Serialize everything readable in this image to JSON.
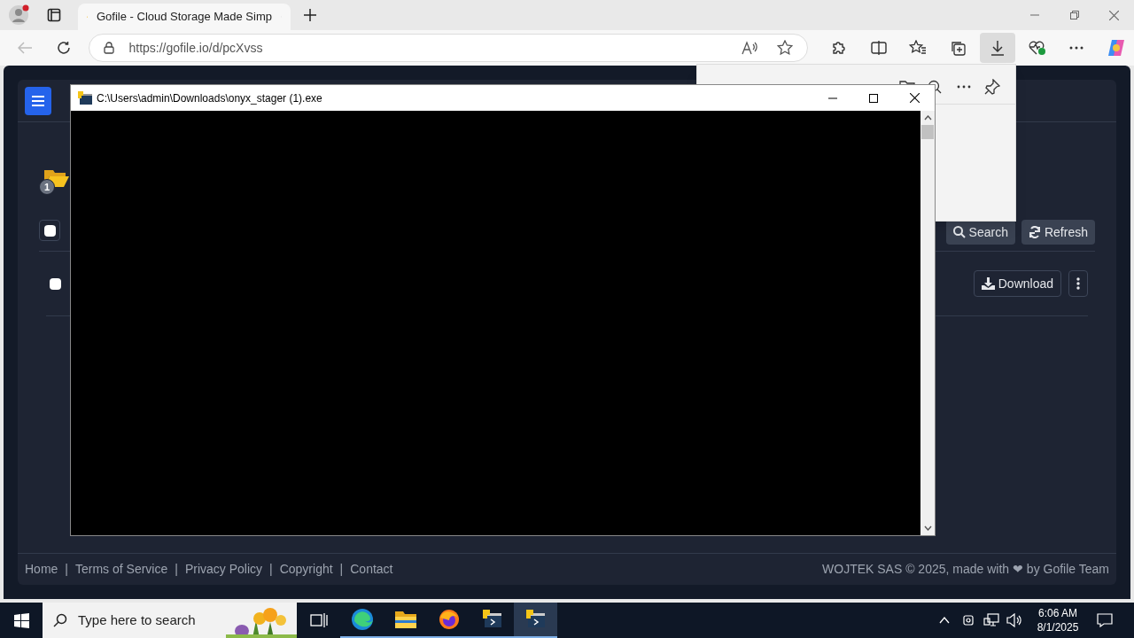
{
  "browser": {
    "tabs": [
      {
        "title": "Gofile - Cloud Storage Made Simp",
        "selected": true
      }
    ],
    "url": "https://gofile.io/d/pcXvss"
  },
  "page": {
    "folder_badge": "1",
    "select_all": {
      "checked": false
    },
    "toolbar_buttons": [
      {
        "kind": "search",
        "label": "Search"
      },
      {
        "kind": "refresh",
        "label": "Refresh"
      }
    ],
    "files": [
      {
        "checked": false,
        "download_label": "Download"
      }
    ],
    "footer_links": [
      "Home",
      "Terms of Service",
      "Privacy Policy",
      "Copyright",
      "Contact"
    ],
    "footer_separator": "|",
    "copyright": "WOJTEK SAS © 2025, made with ❤ by Gofile Team"
  },
  "console_window": {
    "title": "C:\\Users\\admin\\Downloads\\onyx_stager (1).exe"
  },
  "taskbar": {
    "search_placeholder": "Type here to search",
    "apps": [
      {
        "kind": "taskview",
        "active": false
      },
      {
        "kind": "edge",
        "active": false,
        "open": true
      },
      {
        "kind": "explorer",
        "active": false,
        "open": true
      },
      {
        "kind": "firefox",
        "active": false,
        "open": true
      },
      {
        "kind": "python",
        "active": false,
        "open": true
      },
      {
        "kind": "python",
        "active": true,
        "open": true
      }
    ],
    "time": "6:06 AM",
    "date": "8/1/2025"
  }
}
